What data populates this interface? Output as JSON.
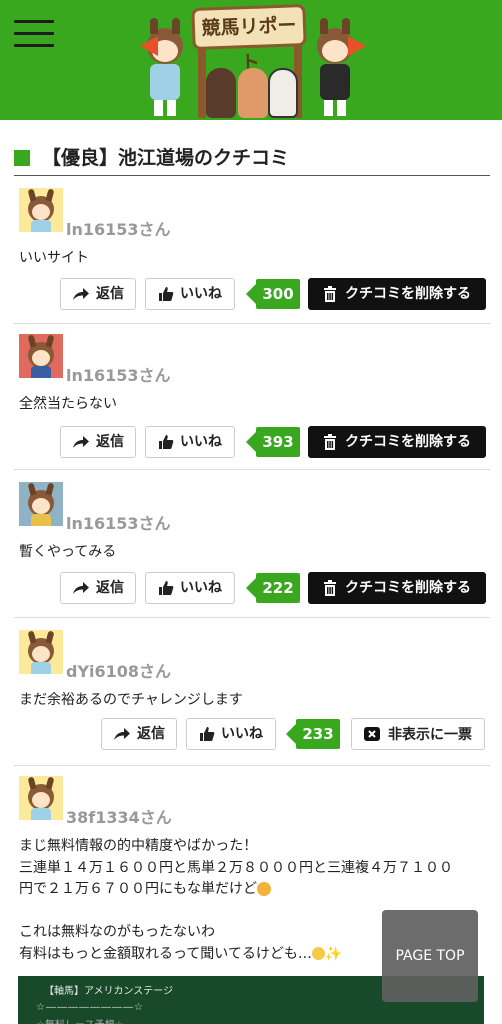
{
  "header": {
    "logo_text": "競馬リポート",
    "brand_color": "#3aa81f"
  },
  "section": {
    "title": "【優良】池江道場のクチコミ"
  },
  "buttons": {
    "reply": "返信",
    "like": "いいね",
    "delete": "クチコミを削除する",
    "hide_vote": "非表示に一票"
  },
  "reviews": [
    {
      "user": "ln16153さん",
      "comment": "いいサイト",
      "likes": "300",
      "avatar_bg": "#fde99a"
    },
    {
      "user": "ln16153さん",
      "comment": "全然当たらない",
      "likes": "393",
      "avatar_bg": "#e06a5e"
    },
    {
      "user": "ln16153さん",
      "comment": "暫くやってみる",
      "likes": "222",
      "avatar_bg": "#8fb3c4"
    },
    {
      "user": "dYi6108さん",
      "comment": "まだ余裕あるのでチャレンジします",
      "likes": "233",
      "avatar_bg": "#fde99a"
    },
    {
      "user": "38f1334さん",
      "avatar_bg": "#fde99a",
      "lines": [
        "まじ無料情報の的中精度やばかった！",
        "三連単１４万１６００円と馬単２万８０００円と三連複４万７１００",
        "円で２１万６７００円にもな単だけど",
        "これは無料なのがもったないわ",
        "有料はもっと金額取れるって聞いてるけども…"
      ]
    }
  ],
  "embed": {
    "title": "【軸馬】アメリカンステージ",
    "line2": "☆――――――――☆",
    "line3": "☆無料レース予想☆"
  },
  "page_top": "PAGE TOP"
}
